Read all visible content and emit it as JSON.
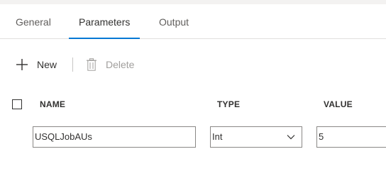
{
  "tabs": [
    {
      "label": "General",
      "active": false
    },
    {
      "label": "Parameters",
      "active": true
    },
    {
      "label": "Output",
      "active": false
    }
  ],
  "toolbar": {
    "new_label": "New",
    "new_icon": "plus-icon",
    "delete_label": "Delete",
    "delete_icon": "trash-icon",
    "delete_enabled": false
  },
  "table": {
    "columns": [
      "NAME",
      "TYPE",
      "VALUE"
    ],
    "rows": [
      {
        "name": "USQLJobAUs",
        "type": "Int",
        "value": "5"
      }
    ]
  },
  "colors": {
    "accent": "#0078d4",
    "text": "#323130",
    "muted": "#605e5c",
    "disabled": "#a19f9d"
  }
}
